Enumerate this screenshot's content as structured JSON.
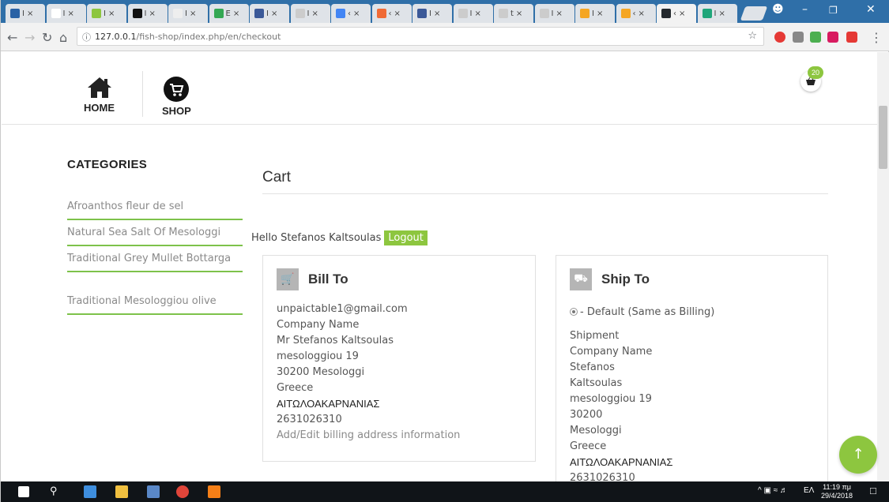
{
  "browser": {
    "tabs": [
      {
        "icon_color": "#2a62a5",
        "label": "Ι"
      },
      {
        "icon_color": "#ffffff",
        "label": "Ι"
      },
      {
        "icon_color": "#8dc63f",
        "label": "Ι"
      },
      {
        "icon_color": "#111111",
        "label": "Ι"
      },
      {
        "icon_color": "#eeeeee",
        "label": "Ι"
      },
      {
        "icon_color": "#34a853",
        "label": "Ε"
      },
      {
        "icon_color": "#3b5998",
        "label": "Ι"
      },
      {
        "icon_color": "#cccccc",
        "label": "Ι"
      },
      {
        "icon_color": "#4285f4",
        "label": "‹"
      },
      {
        "icon_color": "#f06a35",
        "label": "‹"
      },
      {
        "icon_color": "#3b5998",
        "label": "Ι"
      },
      {
        "icon_color": "#cccccc",
        "label": "Ι"
      },
      {
        "icon_color": "#cccccc",
        "label": "t"
      },
      {
        "icon_color": "#cccccc",
        "label": "Ι"
      },
      {
        "icon_color": "#f5a623",
        "label": "Ι"
      },
      {
        "icon_color": "#f5a623",
        "label": "‹"
      },
      {
        "icon_color": "#24292e",
        "label": "‹"
      },
      {
        "icon_color": "#1fa67a",
        "label": "Ι"
      }
    ],
    "url_host": "127.0.0.1",
    "url_path": "/fish-shop/index.php/en/checkout"
  },
  "header": {
    "nav": [
      {
        "label": "HOME",
        "icon": "home-icon"
      },
      {
        "label": "SHOP",
        "icon": "cart-icon"
      }
    ],
    "cart_count": "20"
  },
  "sidebar": {
    "title": "CATEGORIES",
    "items": [
      {
        "label": "Afroanthos fleur de sel"
      },
      {
        "label": "Natural Sea Salt Of Mesologgi"
      },
      {
        "label": "Traditional Grey Mullet Bottarga"
      },
      {
        "label": "Traditional Mesologgiou olive"
      }
    ]
  },
  "main": {
    "title": "Cart",
    "hello": "Hello Stefanos Kaltsoulas",
    "logout": "Logout",
    "bill_to": {
      "title": "Bill To",
      "lines": [
        "unpaictable1@gmail.com",
        "Company Name",
        "Mr Stefanos Kaltsoulas",
        "mesologgiou 19",
        "30200 Mesologgi",
        "Greece",
        "ΑΙΤΩΛΟΑΚΑΡΝΑΝΙΑΣ",
        "2631026310"
      ],
      "edit_link": "Add/Edit billing address information"
    },
    "ship_to": {
      "title": "Ship To",
      "default_option": "- Default (Same as Billing)",
      "lines": [
        "Shipment",
        "Company Name",
        "Stefanos",
        "Kaltsoulas",
        "mesologgiou 19",
        "30200",
        "Mesologgi",
        "Greece",
        "ΑΙΤΩΛΟΑΚΑΡΝΑΝΙΑΣ",
        "2631026310"
      ]
    }
  },
  "taskbar": {
    "lang": "ΕΛ",
    "time": "11:19 πμ",
    "date": "29/4/2018"
  },
  "colors": {
    "accent": "#8dc63f",
    "tabstrip": "#2f6fa8"
  }
}
